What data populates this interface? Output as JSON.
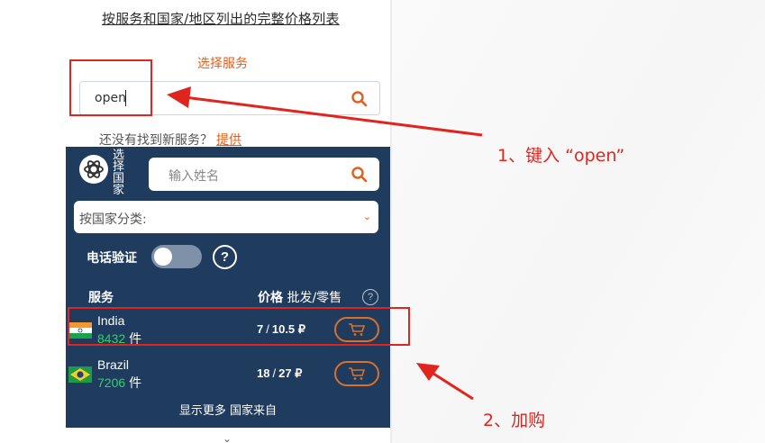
{
  "page": {
    "header_link": "按服务和国家/地区列出的完整价格列表",
    "select_service_label": "选择服务",
    "search": {
      "value": "open"
    },
    "not_found": {
      "text": "还没有找到新服务？",
      "link": "提供"
    }
  },
  "panel": {
    "service_label": "选择国家",
    "name_search_placeholder": "输入姓名",
    "country_filter": "按国家分类:",
    "phone_verify_label": "电话验证",
    "help_symbol": "?",
    "columns": {
      "service": "服务",
      "price_bold": "价格",
      "price_rest": "批发/零售"
    },
    "rows": [
      {
        "country": "India",
        "count": "8432",
        "unit": "件",
        "wholesale": "7",
        "retail": "10.5 ₽"
      },
      {
        "country": "Brazil",
        "count": "7206",
        "unit": "件",
        "wholesale": "18",
        "retail": "27 ₽"
      }
    ],
    "show_more": "显示更多 国家来自"
  },
  "annotations": {
    "step1": "1、键入 “open”",
    "step2": "2、加购"
  },
  "colors": {
    "accent": "#e0601f",
    "panel_bg": "#1f3b5e",
    "annotation_red": "#e0251f",
    "count_green": "#2bd46a"
  },
  "icons": [
    "search-icon",
    "openai-logo-icon",
    "chevron-down-icon",
    "question-icon",
    "cart-icon",
    "flag-india-icon",
    "flag-brazil-icon"
  ]
}
